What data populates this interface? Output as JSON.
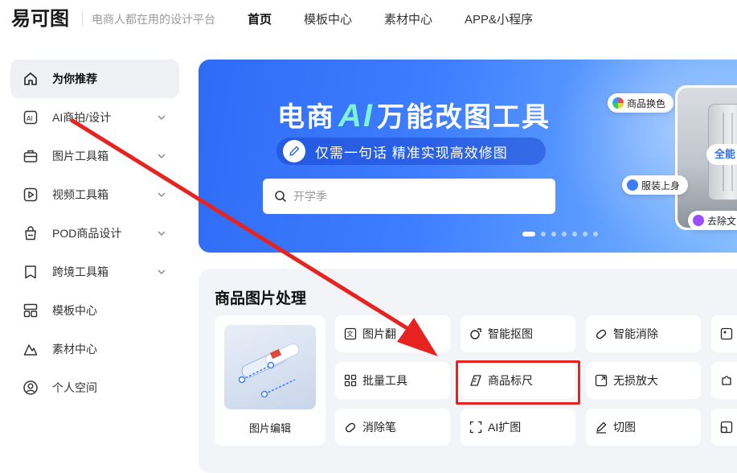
{
  "header": {
    "logo_text": "易可图",
    "slogan": "电商人都在用的设计平台",
    "nav": [
      {
        "label": "首页",
        "active": true
      },
      {
        "label": "模板中心",
        "active": false
      },
      {
        "label": "素材中心",
        "active": false
      },
      {
        "label": "APP&小程序",
        "active": false
      }
    ]
  },
  "sidebar": {
    "items": [
      {
        "label": "为你推荐",
        "icon": "home-icon",
        "active": true,
        "has_chevron": false
      },
      {
        "label": "AI商拍/设计",
        "icon": "ai-icon",
        "active": false,
        "has_chevron": true
      },
      {
        "label": "图片工具箱",
        "icon": "toolbox-icon",
        "active": false,
        "has_chevron": true
      },
      {
        "label": "视频工具箱",
        "icon": "video-icon",
        "active": false,
        "has_chevron": true
      },
      {
        "label": "POD商品设计",
        "icon": "bag-icon",
        "active": false,
        "has_chevron": true
      },
      {
        "label": "跨境工具箱",
        "icon": "bookmark-icon",
        "active": false,
        "has_chevron": true
      },
      {
        "label": "模板中心",
        "icon": "template-icon",
        "active": false,
        "has_chevron": false
      },
      {
        "label": "素材中心",
        "icon": "material-icon",
        "active": false,
        "has_chevron": false
      },
      {
        "label": "个人空间",
        "icon": "user-icon",
        "active": false,
        "has_chevron": false
      }
    ]
  },
  "banner": {
    "title_part1": "电商",
    "title_ai": "AI",
    "title_part2": "万能改图工具",
    "subtitle": "仅需一句话 精准实现高效修图",
    "search_placeholder": "开学季",
    "tag_1": "商品换色",
    "tag_2": "服装上身",
    "tag_3": "去除文",
    "product_badge": "全能",
    "carousel_count": 7,
    "carousel_active": 0,
    "colors": {
      "gradient_start": "#2f6cf6",
      "gradient_end": "#8cc3ff",
      "title_accent": "#7ef3d4"
    }
  },
  "section": {
    "title": "商品图片处理",
    "feature_card_label": "图片编辑",
    "tools": [
      {
        "label": "图片翻",
        "icon": "translate-icon"
      },
      {
        "label": "智能抠图",
        "icon": "cutout-icon"
      },
      {
        "label": "智能消除",
        "icon": "eraser-icon"
      },
      {
        "label": "批量工具",
        "icon": "grid-icon"
      },
      {
        "label": "商品标尺",
        "icon": "ruler-icon"
      },
      {
        "label": "无损放大",
        "icon": "upscale-icon"
      },
      {
        "label": "消除笔",
        "icon": "eraser-pen-icon"
      },
      {
        "label": "AI扩图",
        "icon": "expand-icon"
      },
      {
        "label": "切图",
        "icon": "slice-icon"
      }
    ],
    "highlight_color": "#e8231f"
  }
}
